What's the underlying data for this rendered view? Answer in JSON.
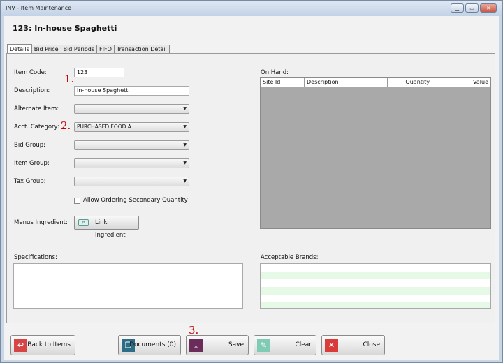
{
  "window": {
    "title": "INV - Item Maintenance",
    "controls": [
      "minimize",
      "restore",
      "close"
    ]
  },
  "header": {
    "title": "123: In-house Spaghetti"
  },
  "tabs": [
    {
      "label": "Details",
      "active": true
    },
    {
      "label": "Bid Price"
    },
    {
      "label": "Bid Periods"
    },
    {
      "label": "FIFO"
    },
    {
      "label": "Transaction Detail"
    }
  ],
  "form": {
    "item_code": {
      "label": "Item Code:",
      "value": "123"
    },
    "description": {
      "label": "Description:",
      "value": "In-house Spaghetti"
    },
    "alternate_item": {
      "label": "Alternate Item:",
      "value": ""
    },
    "acct_category": {
      "label": "Acct. Category:",
      "value": "PURCHASED FOOD A"
    },
    "bid_group": {
      "label": "Bid Group:",
      "value": ""
    },
    "item_group": {
      "label": "Item Group:",
      "value": ""
    },
    "tax_group": {
      "label": "Tax Group:",
      "value": ""
    },
    "allow_secondary": {
      "label": "Allow Ordering Secondary Quantity",
      "checked": false
    },
    "menus_ingredient": {
      "label": "Menus Ingredient:",
      "button": "Link Ingredient"
    }
  },
  "on_hand": {
    "label": "On Hand:",
    "columns": [
      "Site Id",
      "Description",
      "Quantity",
      "Value"
    ],
    "rows": []
  },
  "specifications": {
    "label": "Specifications:",
    "value": ""
  },
  "acceptable_brands": {
    "label": "Acceptable Brands:",
    "rows": []
  },
  "annotations": [
    "1.",
    "2.",
    "3."
  ],
  "footer": {
    "back": "Back to Items",
    "documents": "Documents (0)",
    "save": "Save",
    "clear": "Clear",
    "close": "Close"
  },
  "colors": {
    "back_icon": "#d64545",
    "documents_icon": "#2d6e86",
    "save_icon": "#6a2c5a",
    "clear_icon": "#7fcbb3",
    "close_icon": "#d93a3a",
    "brands_alt_row": "#e6f9e6",
    "annotation": "#c00000"
  }
}
